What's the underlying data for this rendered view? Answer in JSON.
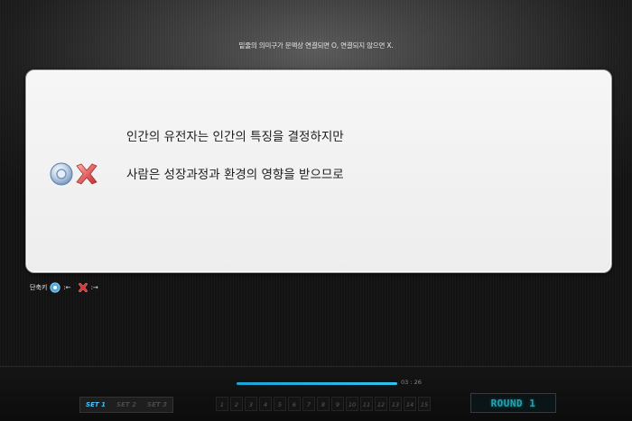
{
  "instruction": "밑줄의 의미구가 문맥상 연결되면 O, 연결되지 않으면 X.",
  "question": {
    "line1": "인간의 유전자는 인간의 특징을 결정하지만",
    "line2": "사람은 성장과정과 환경의 영향을 받으므로"
  },
  "shortcut": {
    "label": "단축키",
    "o_key": ":←",
    "x_key": ":→"
  },
  "timer": {
    "value": "03 : 26",
    "progress_fraction": 1.0
  },
  "sets": [
    {
      "label": "SET 1",
      "active": true
    },
    {
      "label": "SET 2",
      "active": false
    },
    {
      "label": "SET 3",
      "active": false
    }
  ],
  "questions": [
    "1",
    "2",
    "3",
    "4",
    "5",
    "6",
    "7",
    "8",
    "9",
    "10",
    "11",
    "12",
    "13",
    "14",
    "15"
  ],
  "round_label": "ROUND 1",
  "colors": {
    "accent": "#2ec4f0",
    "o_icon": "#4aa8e0",
    "x_icon": "#d83a3a",
    "round": "#1fa6b3"
  }
}
